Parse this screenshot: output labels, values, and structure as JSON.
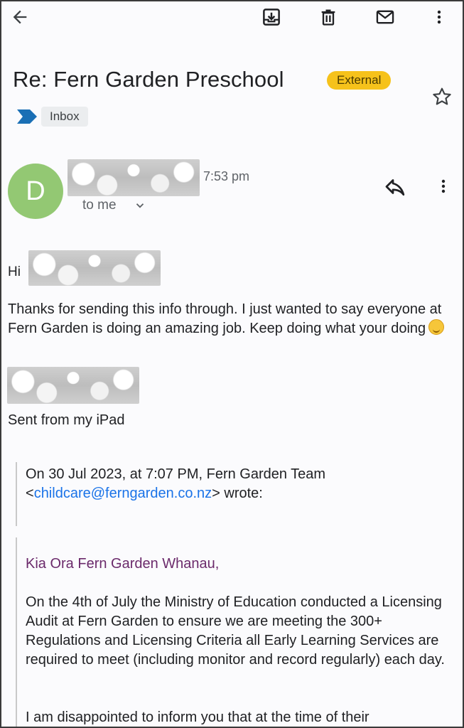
{
  "toolbar": {
    "back_icon": "arrow-back-icon",
    "archive_icon": "archive-icon",
    "delete_icon": "trash-icon",
    "mark_unread_icon": "mail-icon",
    "more_icon": "more-vert-icon"
  },
  "email": {
    "subject": "Re: Fern Garden Preschool",
    "external_badge": "External",
    "label": "Inbox",
    "star_icon": "star-outline-icon"
  },
  "sender": {
    "avatar_initial": "D",
    "avatar_color": "#93c873",
    "time": "7:53 pm",
    "recipient": "to me",
    "reply_icon": "reply-icon"
  },
  "message": {
    "greeting": "Hi",
    "paragraph": "Thanks for sending this info through. I just wanted to say everyone at Fern Garden is doing an amazing job. Keep doing what your doing",
    "emoji": "smiling-face-emoji",
    "footer": "Sent from my iPad"
  },
  "quoted": {
    "attribution_prefix": "On 30 Jul 2023, at 7:07 PM, Fern Garden Team",
    "email_open": "<",
    "email": "childcare@ferngarden.co.nz",
    "email_close": "> wrote:",
    "salutation": "Kia Ora Fern Garden Whanau,",
    "paragraph1": "On the 4th of July the Ministry of Education conducted a Licensing Audit at Fern Garden to ensure we are meeting the 300+ Regulations and Licensing Criteria all Early Learning Services are required to meet (including monitor and record regularly)  each day.",
    "paragraph2": "I am disappointed to inform you that at the time of their"
  },
  "colors": {
    "accent_link": "#1a73e8",
    "external_badge": "#f6c21b",
    "salutation": "#6b2a6b",
    "label_arrow": "#1a6fb5"
  }
}
